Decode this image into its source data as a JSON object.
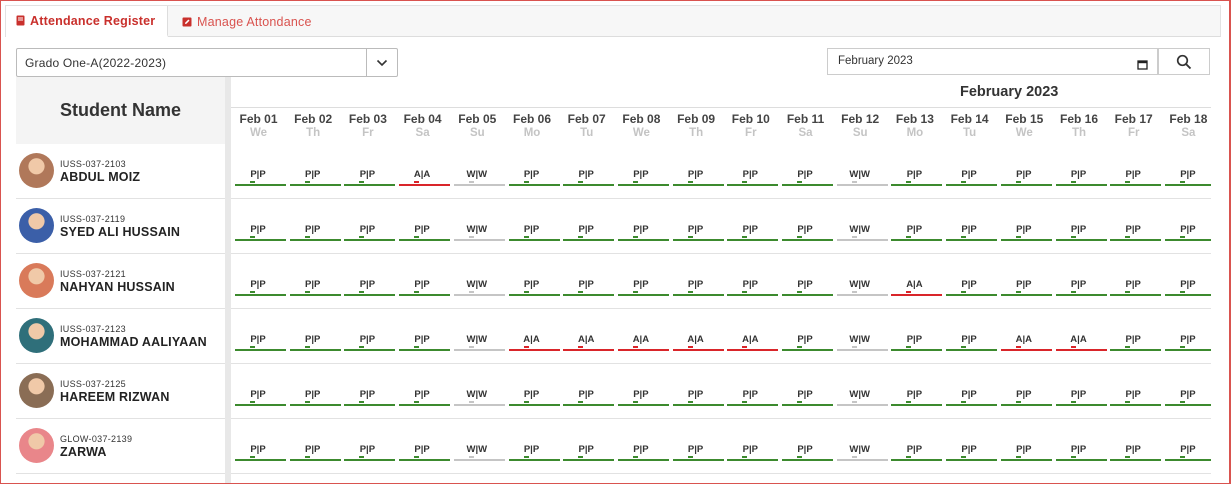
{
  "tabs": [
    {
      "label": "Attendance Register",
      "active": true,
      "icon": "book-icon"
    },
    {
      "label": "Manage Attondance",
      "active": false,
      "icon": "edit-icon"
    }
  ],
  "filters": {
    "class_select_value": "Grado One-A(2022-2023)",
    "month_value": "February 2023"
  },
  "table": {
    "name_header": "Student Name",
    "month_label": "February 2023",
    "days": [
      {
        "date": "Feb 01",
        "weekday": "We"
      },
      {
        "date": "Feb 02",
        "weekday": "Th"
      },
      {
        "date": "Feb 03",
        "weekday": "Fr"
      },
      {
        "date": "Feb 04",
        "weekday": "Sa"
      },
      {
        "date": "Feb 05",
        "weekday": "Su"
      },
      {
        "date": "Feb 06",
        "weekday": "Mo"
      },
      {
        "date": "Feb 07",
        "weekday": "Tu"
      },
      {
        "date": "Feb 08",
        "weekday": "We"
      },
      {
        "date": "Feb 09",
        "weekday": "Th"
      },
      {
        "date": "Feb 10",
        "weekday": "Fr"
      },
      {
        "date": "Feb 11",
        "weekday": "Sa"
      },
      {
        "date": "Feb 12",
        "weekday": "Su"
      },
      {
        "date": "Feb 13",
        "weekday": "Mo"
      },
      {
        "date": "Feb 14",
        "weekday": "Tu"
      },
      {
        "date": "Feb 15",
        "weekday": "We"
      },
      {
        "date": "Feb 16",
        "weekday": "Th"
      },
      {
        "date": "Feb 17",
        "weekday": "Fr"
      },
      {
        "date": "Feb 18",
        "weekday": "Sa"
      }
    ],
    "students": [
      {
        "id": "IUSS-037-2103",
        "name": "ABDUL MOIZ",
        "avatar_color": "#b0785a",
        "marks": [
          "P|P",
          "P|P",
          "P|P",
          "A|A",
          "W|W",
          "P|P",
          "P|P",
          "P|P",
          "P|P",
          "P|P",
          "P|P",
          "W|W",
          "P|P",
          "P|P",
          "P|P",
          "P|P",
          "P|P",
          "P|P"
        ]
      },
      {
        "id": "IUSS-037-2119",
        "name": "SYED ALI HUSSAIN",
        "avatar_color": "#3b5fa8",
        "marks": [
          "P|P",
          "P|P",
          "P|P",
          "P|P",
          "W|W",
          "P|P",
          "P|P",
          "P|P",
          "P|P",
          "P|P",
          "P|P",
          "W|W",
          "P|P",
          "P|P",
          "P|P",
          "P|P",
          "P|P",
          "P|P"
        ]
      },
      {
        "id": "IUSS-037-2121",
        "name": "NAHYAN HUSSAIN",
        "avatar_color": "#d97a5a",
        "marks": [
          "P|P",
          "P|P",
          "P|P",
          "P|P",
          "W|W",
          "P|P",
          "P|P",
          "P|P",
          "P|P",
          "P|P",
          "P|P",
          "W|W",
          "A|A",
          "P|P",
          "P|P",
          "P|P",
          "P|P",
          "P|P"
        ]
      },
      {
        "id": "IUSS-037-2123",
        "name": "MOHAMMAD AALIYAAN",
        "avatar_color": "#2f6f7a",
        "marks": [
          "P|P",
          "P|P",
          "P|P",
          "P|P",
          "W|W",
          "A|A",
          "A|A",
          "A|A",
          "A|A",
          "A|A",
          "P|P",
          "W|W",
          "P|P",
          "P|P",
          "A|A",
          "A|A",
          "P|P",
          "P|P"
        ]
      },
      {
        "id": "IUSS-037-2125",
        "name": "HAREEM RIZWAN",
        "avatar_color": "#8a6d55",
        "marks": [
          "P|P",
          "P|P",
          "P|P",
          "P|P",
          "W|W",
          "P|P",
          "P|P",
          "P|P",
          "P|P",
          "P|P",
          "P|P",
          "W|W",
          "P|P",
          "P|P",
          "P|P",
          "P|P",
          "P|P",
          "P|P"
        ]
      },
      {
        "id": "GLOW-037-2139",
        "name": "ZARWA",
        "avatar_color": "#e9868a",
        "marks": [
          "P|P",
          "P|P",
          "P|P",
          "P|P",
          "W|W",
          "P|P",
          "P|P",
          "P|P",
          "P|P",
          "P|P",
          "P|P",
          "W|W",
          "P|P",
          "P|P",
          "P|P",
          "P|P",
          "P|P",
          "P|P"
        ]
      }
    ]
  },
  "colors": {
    "accent": "#c9302c",
    "present": "#3c8a2e",
    "absent": "#d9252a",
    "weekend": "#c5c5c5"
  }
}
